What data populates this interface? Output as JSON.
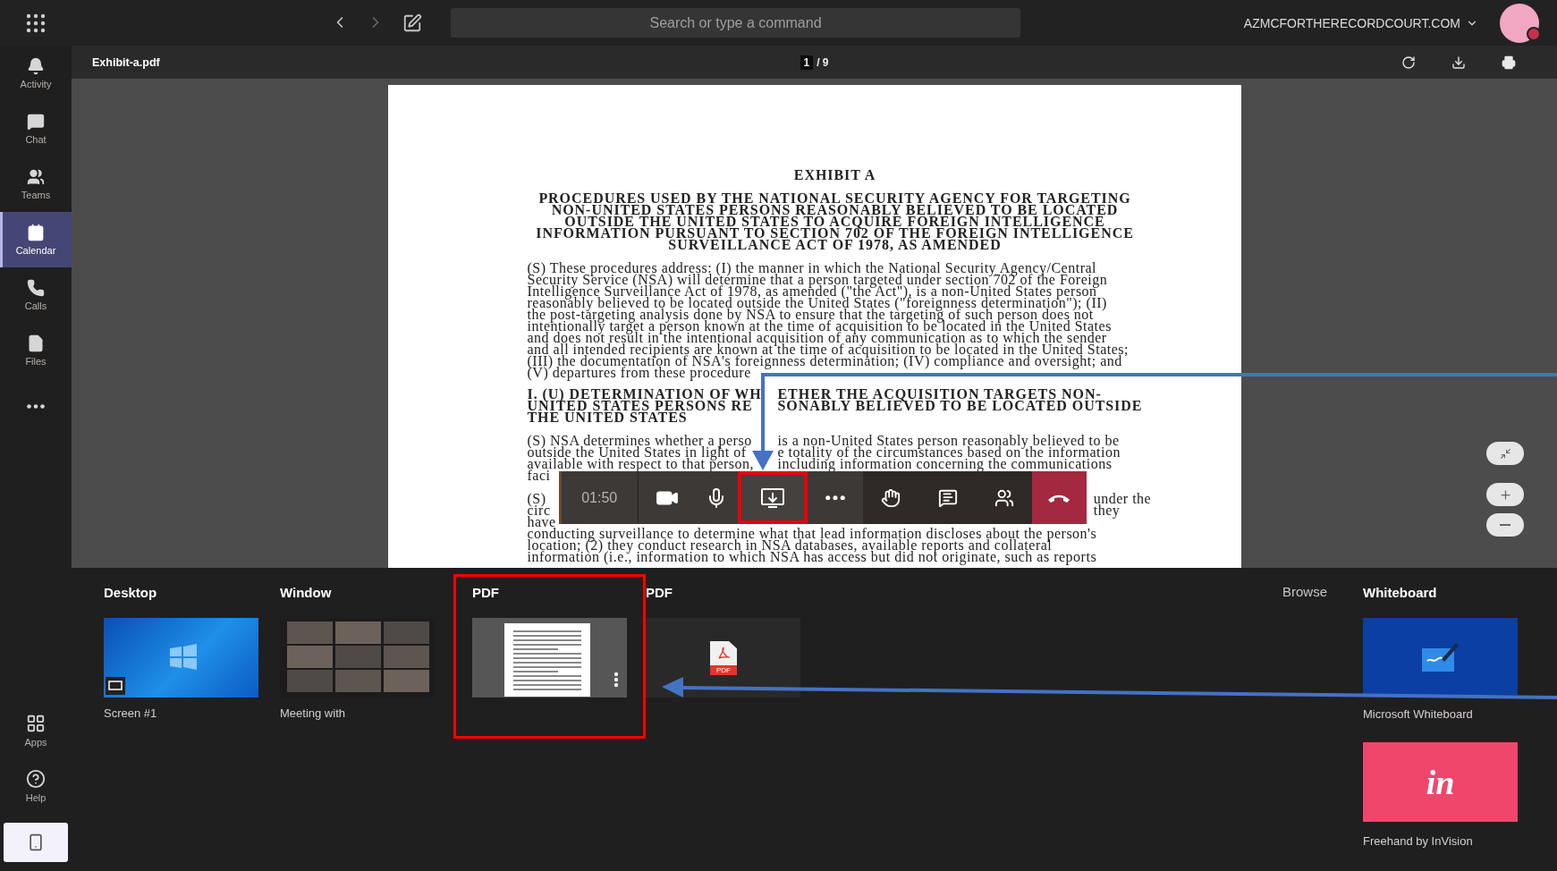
{
  "app_bar": {
    "search": {
      "placeholder": "Search or type a command"
    },
    "account": "AZMCFORTHERECORDCOURT.COM"
  },
  "rail": {
    "items": [
      {
        "kind": "activity",
        "label": "Activity",
        "selected": false
      },
      {
        "kind": "chat",
        "label": "Chat",
        "selected": false
      },
      {
        "kind": "teams",
        "label": "Teams",
        "selected": false
      },
      {
        "kind": "calendar",
        "label": "Calendar",
        "selected": true
      },
      {
        "kind": "calls",
        "label": "Calls",
        "selected": false
      },
      {
        "kind": "files",
        "label": "Files",
        "selected": false
      },
      {
        "kind": "more",
        "selected": false
      }
    ],
    "bottom_items": [
      {
        "kind": "apps",
        "label": "Apps"
      },
      {
        "kind": "help",
        "label": "Help"
      },
      {
        "kind": "device"
      }
    ]
  },
  "viewer": {
    "file_name": "Exhibit-a.pdf",
    "page_number": "1",
    "page_count": "/ 9"
  },
  "document": {
    "exhibit": "EXHIBIT A",
    "title_lines": [
      "PROCEDURES USED BY THE NATIONAL SECURITY AGENCY FOR TARGETING",
      "NON-UNITED STATES PERSONS REASONABLY BELIEVED TO BE LOCATED",
      "OUTSIDE THE UNITED STATES TO ACQUIRE FOREIGN INTELLIGENCE",
      "INFORMATION PURSUANT TO SECTION 702 OF THE FOREIGN INTELLIGENCE",
      "SURVEILLANCE ACT OF 1978, AS AMENDED"
    ],
    "paragraph_1_lines": [
      "(S) These procedures address: (I) the manner in which the National Security Agency/Central",
      "Security Service (NSA) will determine that a person targeted under section 702 of the Foreign",
      "Intelligence Surveillance Act of 1978, as amended (\"the Act\"), is a non-United States person",
      "reasonably believed to be located outside the United States (\"foreignness determination\"); (II)",
      "the post-targeting analysis done by NSA to ensure that the targeting of such person does not",
      "intentionally target a person known at the time of acquisition to be located in the United States",
      "and does not result in the intentional acquisition of any communication as to which the sender",
      "and all intended recipients are known at the time of acquisition to be located in the United States;",
      "(III) the documentation of NSA's foreignness determination; (IV) compliance and oversight; and",
      "(V) departures from these procedure"
    ],
    "heading_lines": [
      {
        "left": "I. (U) DETERMINATION OF WH",
        "right": "ETHER THE ACQUISITION TARGETS NON-"
      },
      {
        "left": "UNITED STATES PERSONS RE",
        "right": "SONABLY BELIEVED TO BE LOCATED OUTSIDE"
      },
      {
        "text": "THE UNITED STATES"
      }
    ],
    "paragraph_2_lines": [
      {
        "left": "(S) NSA determines whether a perso",
        "right": "is a non-United States person reasonably believed to be"
      },
      {
        "left": "outside the United States in light of",
        "right": "e totality of the circumstances based on the information"
      },
      {
        "left": "available with respect to that person,",
        "right": "including information concerning the communications"
      }
    ],
    "covered_left": [
      [
        "faci"
      ],
      [
        "(S)",
        "circ",
        "have"
      ]
    ],
    "covered_right": [
      "under the",
      "they"
    ],
    "lower_lines": [
      "conducting surveillance to determine what that lead information discloses about the person's",
      "location; (2) they conduct research in NSA databases, available reports and collateral",
      "information (i.e., information to which NSA has access but did not originate, such as reports"
    ]
  },
  "call_toolbar": {
    "timer": "01:50",
    "controls": [
      {
        "kind": "camera",
        "highlighted": false
      },
      {
        "kind": "mic",
        "highlighted": false
      },
      {
        "kind": "share",
        "highlighted": true
      },
      {
        "kind": "more",
        "highlighted": false
      },
      {
        "kind": "hand",
        "highlighted": false
      },
      {
        "kind": "chat",
        "highlighted": false
      },
      {
        "kind": "people",
        "highlighted": false
      },
      {
        "kind": "hangup",
        "highlighted": false
      }
    ]
  },
  "share_tray": {
    "columns": [
      {
        "title": "Desktop",
        "highlighted": false,
        "tile": {
          "kind": "desktop",
          "label": "Screen #1"
        }
      },
      {
        "title": "Window",
        "highlighted": false,
        "tile": {
          "kind": "meeting",
          "label": "Meeting with"
        }
      },
      {
        "title": "PDF",
        "highlighted": true,
        "tile": {
          "kind": "pdf-preview"
        }
      },
      {
        "title": "PDF",
        "highlighted": false,
        "tile": {
          "kind": "pdf-file",
          "icon_text": "PDF"
        }
      }
    ],
    "browse": "Browse",
    "apps": {
      "title": "Whiteboard",
      "tiles": [
        {
          "kind": "whiteboard",
          "label": "Microsoft Whiteboard"
        },
        {
          "kind": "invision",
          "logo": "in",
          "label": "Freehand by InVision"
        }
      ]
    }
  }
}
